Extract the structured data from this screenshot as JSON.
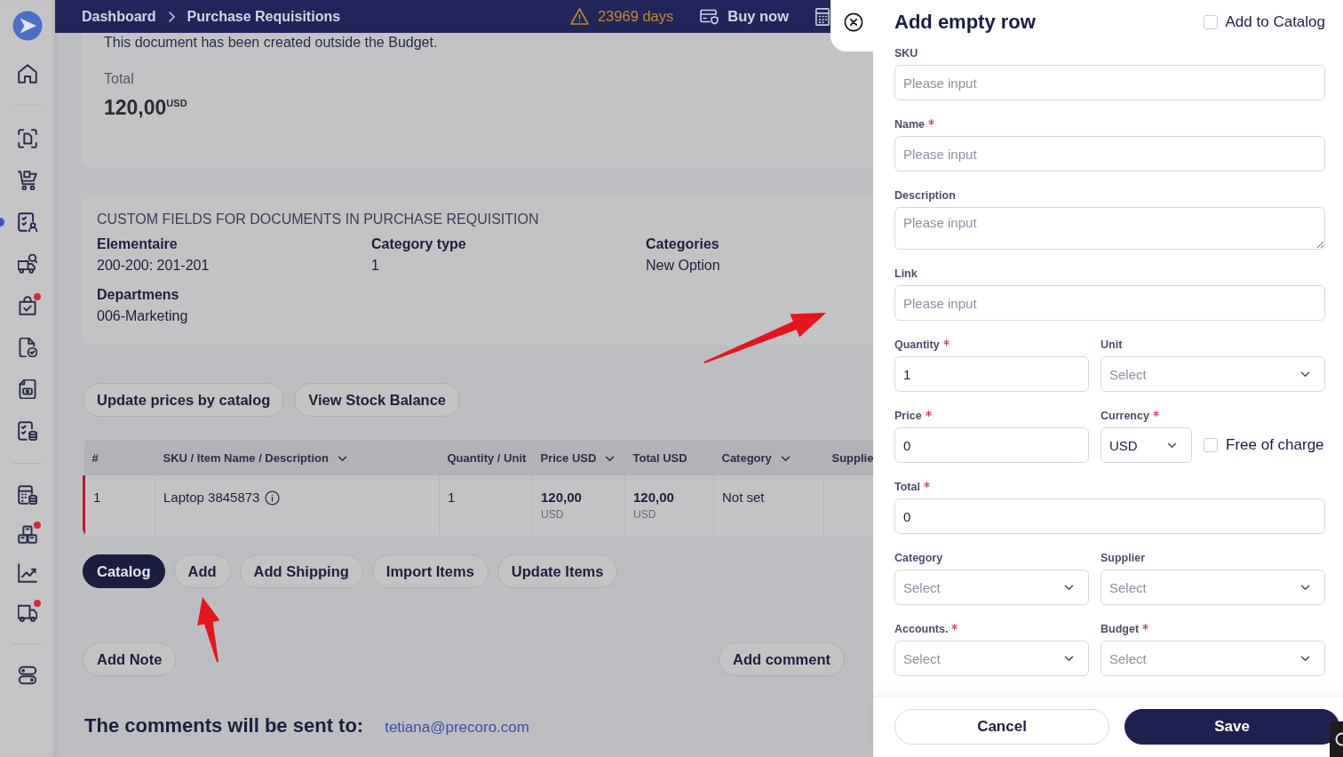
{
  "sidebar": {
    "groups": [
      {
        "items": [
          {
            "selected": false,
            "notify": false
          }
        ]
      },
      {
        "items": [
          {
            "selected": false,
            "notify": false
          },
          {
            "selected": false,
            "notify": false
          },
          {
            "selected": true,
            "notify": false
          },
          {
            "selected": false,
            "notify": false
          },
          {
            "selected": false,
            "notify": true
          },
          {
            "selected": false,
            "notify": false
          },
          {
            "selected": false,
            "notify": false
          },
          {
            "selected": false,
            "notify": false
          }
        ]
      },
      {
        "items": [
          {
            "selected": false,
            "notify": false
          },
          {
            "selected": false,
            "notify": true
          },
          {
            "selected": false,
            "notify": false
          },
          {
            "selected": false,
            "notify": true
          }
        ]
      },
      {
        "items": [
          {
            "selected": false,
            "notify": false
          }
        ]
      }
    ]
  },
  "top_bar": {
    "breadcrumbs": [
      "Dashboard",
      "Purchase Requisitions"
    ],
    "trial_left": "23969 days",
    "buy_now": "Buy now"
  },
  "summary": {
    "notice": "This document has been created outside the Budget.",
    "total_label": "Total",
    "total": "120,00$^{USD}$"
  },
  "custom_fields": {
    "title": "CUSTOM FIELDS FOR DOCUMENTS IN PURCHASE REQUISITION",
    "items": [
      {
        "label": "Elementaire",
        "value": "200-200: 201-201"
      },
      {
        "label": "Category type",
        "value": "1"
      },
      {
        "label": "Categories",
        "value": "New Option"
      },
      {
        "label": "Departmens",
        "value": "006-Marketing"
      }
    ]
  },
  "item_actions": [
    {
      "label": "Update prices by catalog",
      "primary": false
    },
    {
      "label": "View Stock Balance",
      "primary": false
    }
  ],
  "table": {
    "columns": [
      {
        "label": "#",
        "sortable": false
      },
      {
        "label": "SKU / Item Name / Description",
        "sortable": true
      },
      {
        "label": "Quantity / Unit",
        "sortable": false
      },
      {
        "label": "Price USD",
        "sortable": true
      },
      {
        "label": "Total USD",
        "sortable": false
      },
      {
        "label": "Category",
        "sortable": true
      },
      {
        "label": "Supplie",
        "sortable": false
      }
    ],
    "rows": [
      {
        "flagged": true,
        "cells": [
          {
            "kind": "text",
            "text": "1"
          },
          {
            "kind": "info",
            "text": "Laptop 3845873"
          },
          {
            "kind": "text",
            "text": "1"
          },
          {
            "kind": "money",
            "amount": "120,00",
            "currency": "USD"
          },
          {
            "kind": "money",
            "amount": "120,00",
            "currency": "USD"
          },
          {
            "kind": "text",
            "text": "Not set"
          },
          {
            "kind": "empty"
          }
        ]
      }
    ]
  },
  "table_actions": [
    {
      "label": "Catalog",
      "primary": true
    },
    {
      "label": "Add",
      "primary": false
    },
    {
      "label": "Add Shipping",
      "primary": false
    },
    {
      "label": "Import Items",
      "primary": false
    },
    {
      "label": "Update Items",
      "primary": false
    }
  ],
  "note_actions": [
    "Add Note",
    "Add comment"
  ],
  "recipients": {
    "label": "The comments will be sent to:",
    "email": "tetiana@precoro.com"
  },
  "drawer": {
    "title": "Add empty row",
    "add_to_catalog": {
      "label": "Add to Catalog",
      "checked": false
    },
    "rows": [
      {
        "fields": [
          {
            "kind": "text",
            "label": "SKU",
            "required": false,
            "placeholder": "Please input"
          }
        ]
      },
      {
        "fields": [
          {
            "kind": "text",
            "label": "Name",
            "required": true,
            "placeholder": "Please input"
          }
        ]
      },
      {
        "fields": [
          {
            "kind": "textarea",
            "label": "Description",
            "required": false,
            "placeholder": "Please input"
          }
        ]
      },
      {
        "fields": [
          {
            "kind": "text",
            "label": "Link",
            "required": false,
            "placeholder": "Please input"
          }
        ]
      },
      {
        "fields": [
          {
            "kind": "text",
            "label": "Quantity",
            "required": true,
            "value": "1"
          },
          {
            "kind": "select",
            "label": "Unit",
            "required": false,
            "placeholder": "Select"
          }
        ]
      },
      {
        "fields": [
          {
            "kind": "text",
            "label": "Price",
            "required": true,
            "value": "0"
          },
          {
            "kind": "select",
            "label": "Currency",
            "required": true,
            "value": "USD"
          },
          {
            "kind": "checkbox",
            "label": "Free of charge",
            "checked": false
          }
        ]
      },
      {
        "fields": [
          {
            "kind": "text",
            "label": "Total",
            "required": true,
            "value": "0"
          }
        ]
      },
      {
        "fields": [
          {
            "kind": "select",
            "label": "Category",
            "required": false,
            "placeholder": "Select"
          },
          {
            "kind": "select",
            "label": "Supplier",
            "required": false,
            "placeholder": "Select"
          }
        ]
      },
      {
        "fields": [
          {
            "kind": "select",
            "label": "Accounts.",
            "required": true,
            "placeholder": "Select"
          },
          {
            "kind": "select",
            "label": "Budget",
            "required": true,
            "placeholder": "Select"
          }
        ]
      }
    ],
    "buttons": [
      {
        "label": "Cancel",
        "primary": false
      },
      {
        "label": "Save",
        "primary": true
      }
    ]
  }
}
